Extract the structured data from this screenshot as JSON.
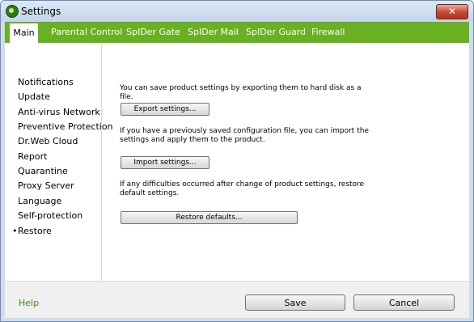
{
  "window": {
    "title": "Settings",
    "close_glyph": "✕"
  },
  "tabs": [
    {
      "label": "Main",
      "active": true
    },
    {
      "label": "Parental Control",
      "active": false
    },
    {
      "label": "SpIDer Gate",
      "active": false
    },
    {
      "label": "SpIDer Mail",
      "active": false
    },
    {
      "label": "SpIDer Guard",
      "active": false
    },
    {
      "label": "Firewall",
      "active": false
    }
  ],
  "sidebar": {
    "items": [
      {
        "label": "Notifications"
      },
      {
        "label": "Update"
      },
      {
        "label": "Anti-virus Network"
      },
      {
        "label": "Preventive Protection"
      },
      {
        "label": "Dr.Web Cloud"
      },
      {
        "label": "Report"
      },
      {
        "label": "Quarantine"
      },
      {
        "label": "Proxy Server"
      },
      {
        "label": "Language"
      },
      {
        "label": "Self-protection"
      },
      {
        "label": "Restore",
        "selected": true
      }
    ],
    "selected_bullet": "•"
  },
  "main": {
    "export_text": "You can save product settings by exporting them to hard disk as a file.",
    "export_button": "Export settings...",
    "import_text": "If you have a previously saved configuration file, you can import the settings and apply them to the product.",
    "import_button": "Import settings...",
    "restore_text": "If any difficulties occurred after change of product settings, restore default settings.",
    "restore_button": "Restore defaults..."
  },
  "footer": {
    "help": "Help",
    "save": "Save",
    "cancel": "Cancel"
  },
  "colors": {
    "tabbar": "#6ab023",
    "help_link": "#3e8b13"
  }
}
